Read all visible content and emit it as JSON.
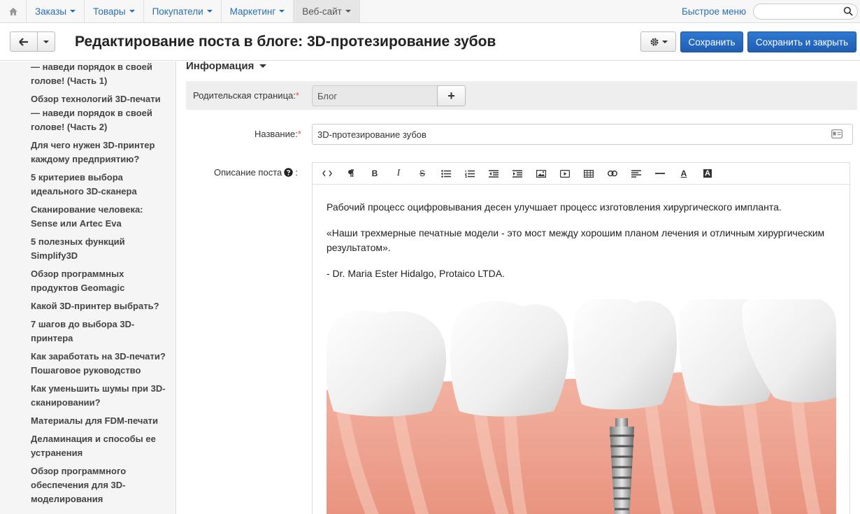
{
  "nav": {
    "items": [
      {
        "label": "Заказы",
        "name": "nav-orders"
      },
      {
        "label": "Товары",
        "name": "nav-products"
      },
      {
        "label": "Покупатели",
        "name": "nav-customers"
      },
      {
        "label": "Маркетинг",
        "name": "nav-marketing"
      },
      {
        "label": "Веб-сайт",
        "name": "nav-website",
        "active": true
      }
    ],
    "quick_menu": "Быстрое меню",
    "search_placeholder": ""
  },
  "header": {
    "title": "Редактирование поста в блоге: 3D-протезирование зубов",
    "save_label": "Сохранить",
    "save_close_label": "Сохранить и закрыть"
  },
  "sidebar": {
    "items": [
      "— наведи порядок в своей голове! (Часть 1)",
      "Обзор технологий 3D-печати — наведи порядок в своей голове! (Часть 2)",
      "Для чего нужен 3D-принтер каждому предприятию?",
      "5 критериев выбора идеального 3D-сканера",
      "Сканирование человека: Sense или Artec Eva",
      "5 полезных функций Simplify3D",
      "Обзор программных продуктов Geomagic",
      "Какой 3D-принтер выбрать?",
      "7 шагов до выбора 3D-принтера",
      "Как заработать на 3D-печати? Пошаговое руководство",
      "Как уменьшить шумы при 3D-сканировании?",
      "Материалы для FDM-печати",
      "Деламинация и способы ее устранения",
      "Обзор программного обеспечения для 3D-моделирования"
    ]
  },
  "form": {
    "section_title": "Информация",
    "parent_label": "Родительская страница:",
    "parent_value": "Блог",
    "name_label": "Название:",
    "name_value": "3D-протезирование зубов",
    "description_label": "Описание поста",
    "required_mark": "*"
  },
  "editor": {
    "paragraphs": [
      "Рабочий процесс оцифровывания десен улучшает процесс изготовления хирургического импланта.",
      "«Наши трехмерные печатные модели - это мост между хорошим планом лечения и отличным хирургическим результатом».",
      "- Dr. Maria Ester Hidalgo, Protaico LTDA."
    ],
    "toolbar": [
      "code-icon",
      "paragraph-icon",
      "bold-icon",
      "italic-icon",
      "strikethrough-icon",
      "bullet-list-icon",
      "numbered-list-icon",
      "outdent-icon",
      "indent-icon",
      "image-icon",
      "video-icon",
      "table-icon",
      "link-icon",
      "align-icon",
      "horizontal-rule-icon",
      "font-color-icon",
      "background-color-icon"
    ]
  },
  "colors": {
    "link": "#2a6fb0",
    "primary": "#2670c8",
    "gum": "#f0a898",
    "tooth": "#f4f4f4"
  }
}
